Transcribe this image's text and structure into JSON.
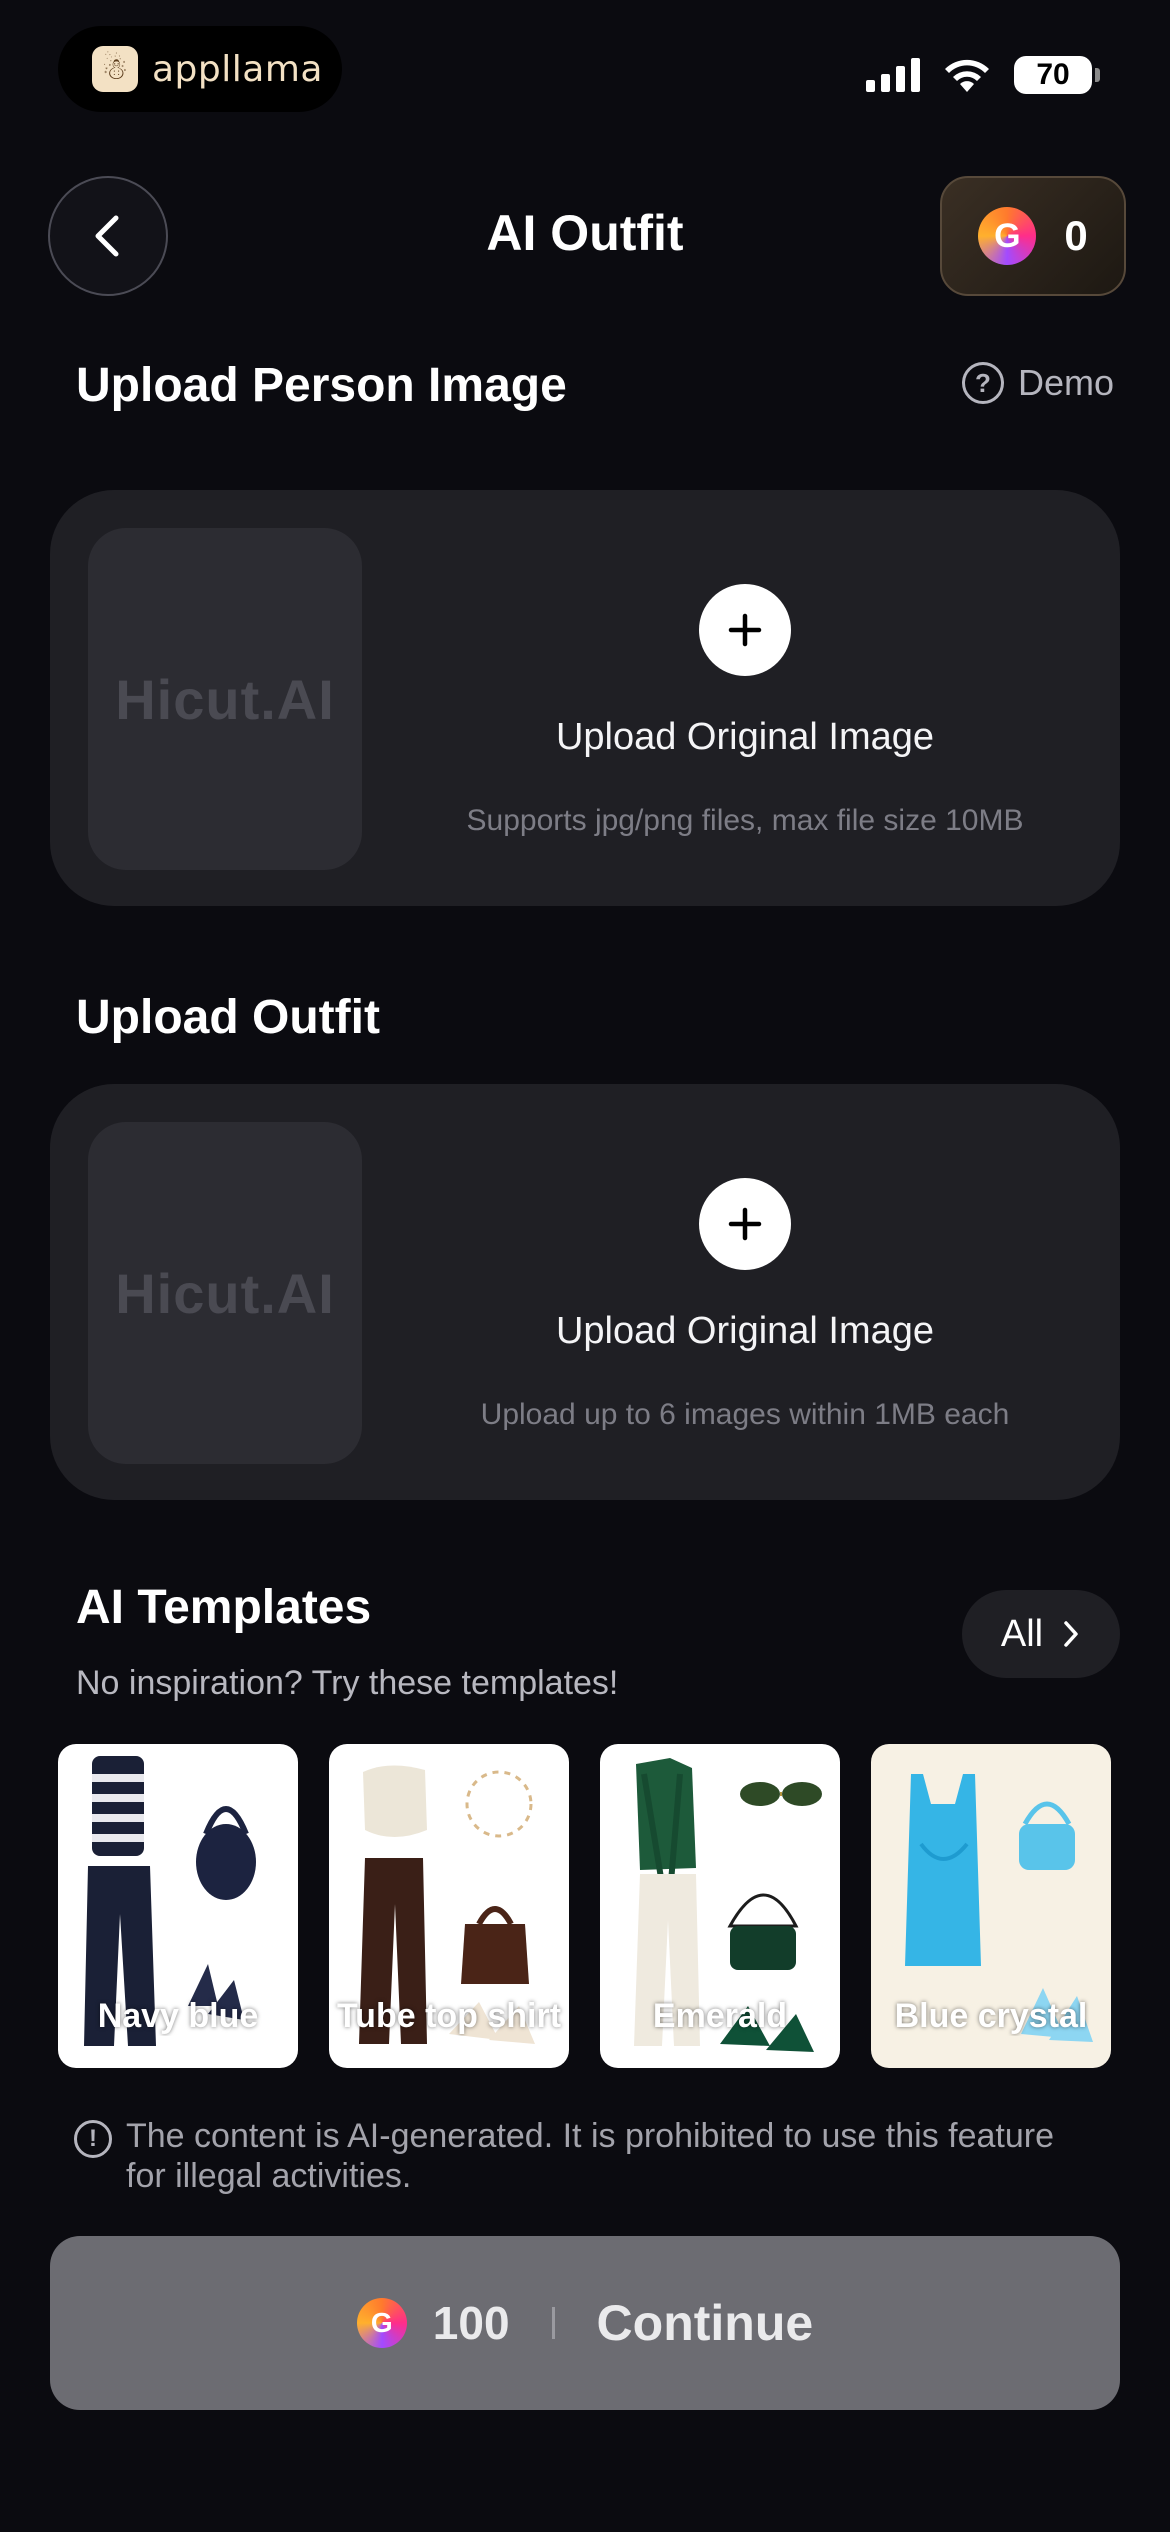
{
  "status_bar": {
    "brand_name": "appllama",
    "battery": "70"
  },
  "header": {
    "title": "AI Outfit",
    "credits": "0"
  },
  "person_section": {
    "title": "Upload Person Image",
    "demo_label": "Demo",
    "watermark": "Hicut.AI",
    "upload_label": "Upload Original Image",
    "hint": "Supports jpg/png files, max file size 10MB"
  },
  "outfit_section": {
    "title": "Upload Outfit",
    "watermark": "Hicut.AI",
    "upload_label": "Upload Original Image",
    "hint": "Upload up to 6 images within 1MB each"
  },
  "templates": {
    "title": "AI Templates",
    "subtitle": "No inspiration? Try these templates!",
    "all_label": "All",
    "items": [
      {
        "label": "Navy blue"
      },
      {
        "label": "Tube top shirt"
      },
      {
        "label": "Emerald"
      },
      {
        "label": "Blue crystal"
      }
    ]
  },
  "disclaimer": "The content is AI-generated. It is prohibited to use this feature for illegal activities.",
  "footer": {
    "cost": "100",
    "continue_label": "Continue"
  },
  "colors": {
    "background": "#0b0b10",
    "card": "#1f1f24",
    "continue_button": "#6c6c72"
  }
}
